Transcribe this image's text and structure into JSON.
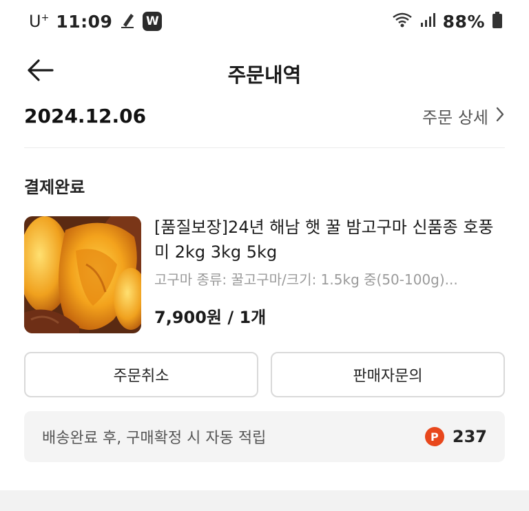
{
  "status_bar": {
    "carrier": "U",
    "carrier_sup": "+",
    "time": "11:09",
    "app_badge": "W",
    "battery": "88%"
  },
  "header": {
    "title": "주문내역",
    "back_icon": "arrow-left-icon"
  },
  "order": {
    "date": "2024.12.06",
    "detail_label": "주문 상세",
    "payment_status": "결제완료"
  },
  "product": {
    "name": "[품질보장]24년 해남 햇 꿀 밤고구마 신품종 호풍미 2kg 3kg 5kg",
    "option": "고구마 종류: 꿀고구마/크기: 1.5kg 중(50-100g)...",
    "price": "7,900원 / 1개"
  },
  "actions": {
    "cancel_label": "주문취소",
    "inquiry_label": "판매자문의"
  },
  "points": {
    "description": "배송완료 후, 구매확정 시 자동 적립",
    "icon_letter": "P",
    "value": "237"
  },
  "colors": {
    "point_badge": "#e8471c",
    "points_bg": "#f4f4f4",
    "border": "#d9d9d9"
  }
}
